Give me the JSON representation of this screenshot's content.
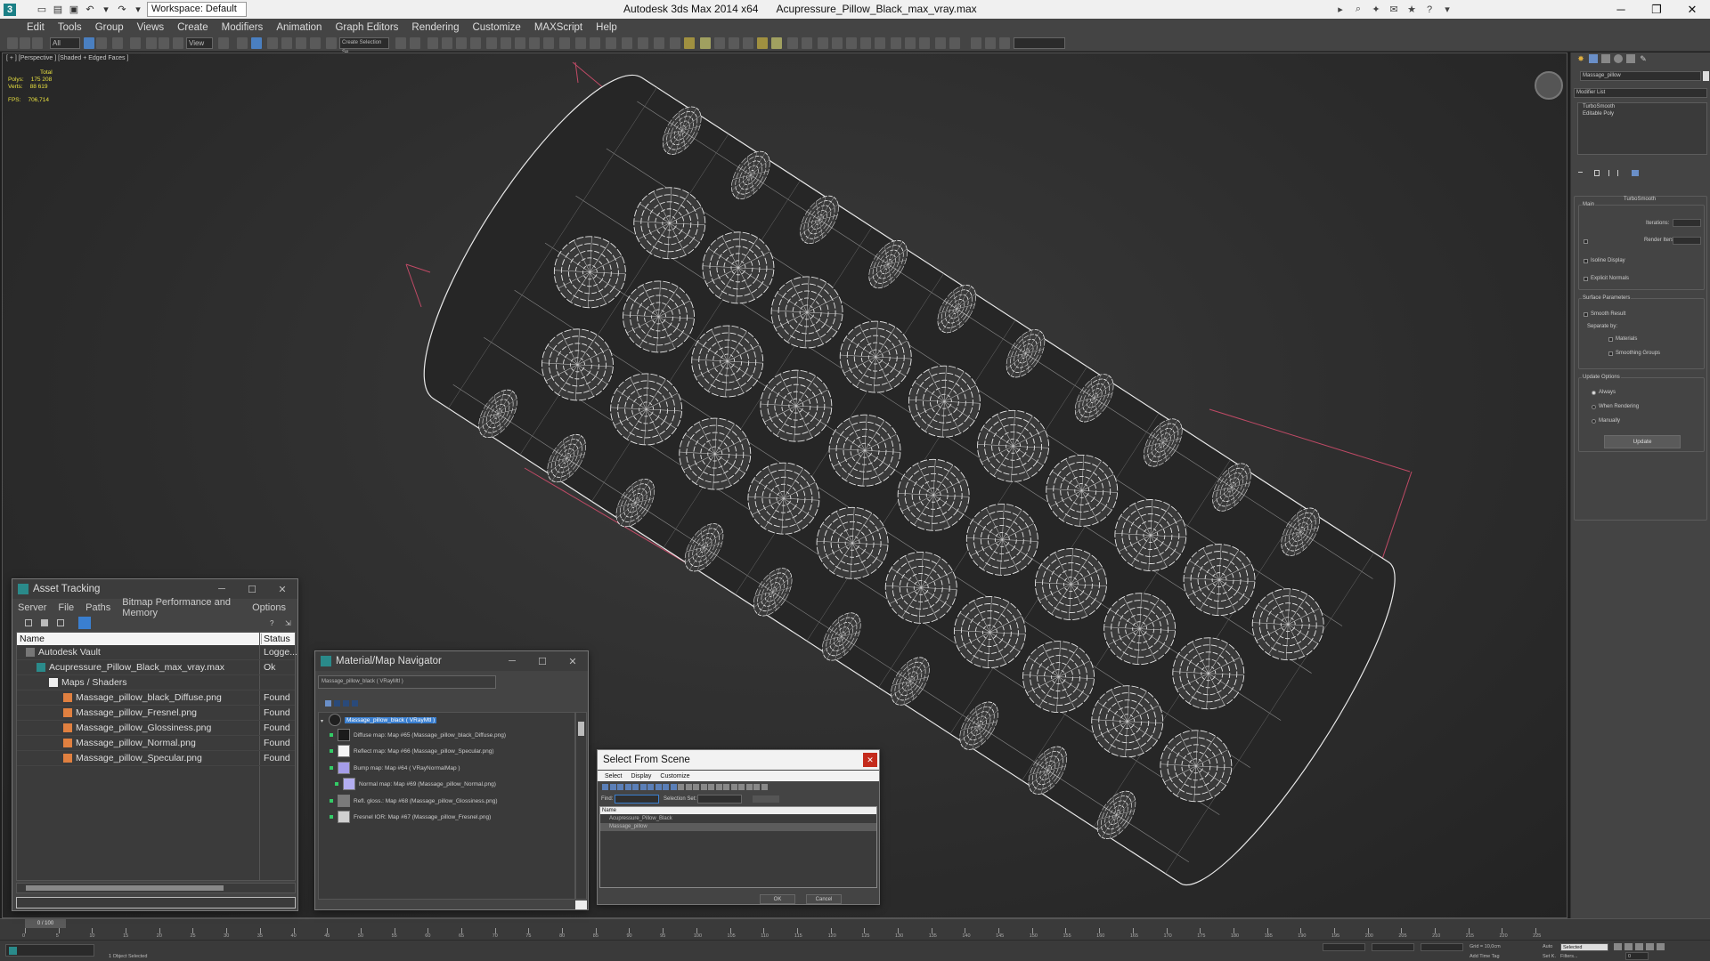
{
  "titlebar": {
    "workspace": "Workspace: Default",
    "app": "Autodesk 3ds Max  2014 x64",
    "file": "Acupressure_Pillow_Black_max_vray.max"
  },
  "menu": [
    "Edit",
    "Tools",
    "Group",
    "Views",
    "Create",
    "Modifiers",
    "Animation",
    "Graph Editors",
    "Rendering",
    "Customize",
    "MAXScript",
    "Help"
  ],
  "toolbar": {
    "filter_select": "All",
    "coord_select": "View",
    "selection_set": "Create Selection Se"
  },
  "viewport": {
    "label": "[ + ] [Perspective ] [Shaded + Edged Faces ]",
    "stats": {
      "total_label": "Total",
      "polys_label": "Polys:",
      "polys": "175 208",
      "verts_label": "Verts:",
      "verts": "88 619",
      "fps_label": "FPS:",
      "fps": "706,714"
    }
  },
  "command_panel": {
    "object_name": "Massage_pillow",
    "modifier_list": "Modifier List",
    "stack": [
      "TurboSmooth",
      "Editable Poly"
    ],
    "rollout_title": "TurboSmooth",
    "main_label": "Main",
    "iterations_label": "Iterations:",
    "render_iters_label": "Render Iters:",
    "isoline": "Isoline Display",
    "explicit_normals": "Explicit Normals",
    "surface_params": "Surface Parameters",
    "smooth_result": "Smooth Result",
    "separate_by": "Separate by:",
    "materials": "Materials",
    "smoothing_groups": "Smoothing Groups",
    "update_options": "Update Options",
    "always": "Always",
    "when_rendering": "When Rendering",
    "manually": "Manually",
    "update_button": "Update"
  },
  "asset_tracking": {
    "title": "Asset Tracking",
    "menu": [
      "Server",
      "File",
      "Paths",
      "Bitmap Performance and Memory",
      "Options"
    ],
    "col_name": "Name",
    "col_status": "Status",
    "rows": [
      {
        "name": "Autodesk Vault",
        "status": "Logge..."
      },
      {
        "name": "Acupressure_Pillow_Black_max_vray.max",
        "status": "Ok"
      },
      {
        "name": "Maps / Shaders",
        "status": ""
      },
      {
        "name": "Massage_pillow_black_Diffuse.png",
        "status": "Found"
      },
      {
        "name": "Massage_pillow_Fresnel.png",
        "status": "Found"
      },
      {
        "name": "Massage_pillow_Glossiness.png",
        "status": "Found"
      },
      {
        "name": "Massage_pillow_Normal.png",
        "status": "Found"
      },
      {
        "name": "Massage_pillow_Specular.png",
        "status": "Found"
      }
    ]
  },
  "material_navigator": {
    "title": "Material/Map Navigator",
    "current": "Massage_pillow_black  ( VRayMtl )",
    "nodes": [
      {
        "label": "Massage_pillow_black  ( VRayMtl )",
        "color": "#202020"
      },
      {
        "label": "Diffuse map: Map #65 (Massage_pillow_black_Diffuse.png)",
        "color": "#1a1a1a"
      },
      {
        "label": "Reflect map: Map #66 (Massage_pillow_Specular.png)",
        "color": "#f4f4f4"
      },
      {
        "label": "Bump map: Map #64  ( VRayNormalMap )",
        "color": "#a59de8"
      },
      {
        "label": "Normal map: Map #69 (Massage_pillow_Normal.png)",
        "color": "#b3aef0"
      },
      {
        "label": "Refl. gloss.: Map #68 (Massage_pillow_Glossiness.png)",
        "color": "#7a7a7a"
      },
      {
        "label": "Fresnel IOR: Map #67 (Massage_pillow_Fresnel.png)",
        "color": "#d0d0d0"
      }
    ]
  },
  "select_from_scene": {
    "title": "Select From Scene",
    "menu": [
      "Select",
      "Display",
      "Customize"
    ],
    "find_label": "Find:",
    "selection_set_label": "Selection Set:",
    "col_name": "Name",
    "items": [
      "Acupressure_Pillow_Black",
      "Massage_pillow"
    ],
    "ok": "OK",
    "cancel": "Cancel"
  },
  "timeline": {
    "frame": "0 / 100",
    "ticks": [
      "0",
      "5",
      "10",
      "15",
      "20",
      "25",
      "30",
      "35",
      "40",
      "45",
      "50",
      "55",
      "60",
      "65",
      "70",
      "75",
      "80",
      "85",
      "90",
      "95",
      "100",
      "105",
      "110",
      "115",
      "120",
      "125",
      "130",
      "135",
      "140",
      "145",
      "150",
      "155",
      "160",
      "165",
      "170",
      "175",
      "180",
      "185",
      "190",
      "195",
      "200",
      "205",
      "210",
      "215",
      "220",
      "225"
    ]
  },
  "status": {
    "objects": "1 Object Selected",
    "grid": "Grid = 10,0cm",
    "auto": "Auto",
    "selected": "Selected",
    "set_key": "Set K.",
    "filters": "Filters...",
    "add_time_tag": "Add Time Tag",
    "frame_value": "0"
  },
  "colors": {
    "viewport_bg": "#2e2e2e",
    "wire": "#e8e8e8",
    "bbox": "#d04060",
    "panel": "#444444"
  }
}
